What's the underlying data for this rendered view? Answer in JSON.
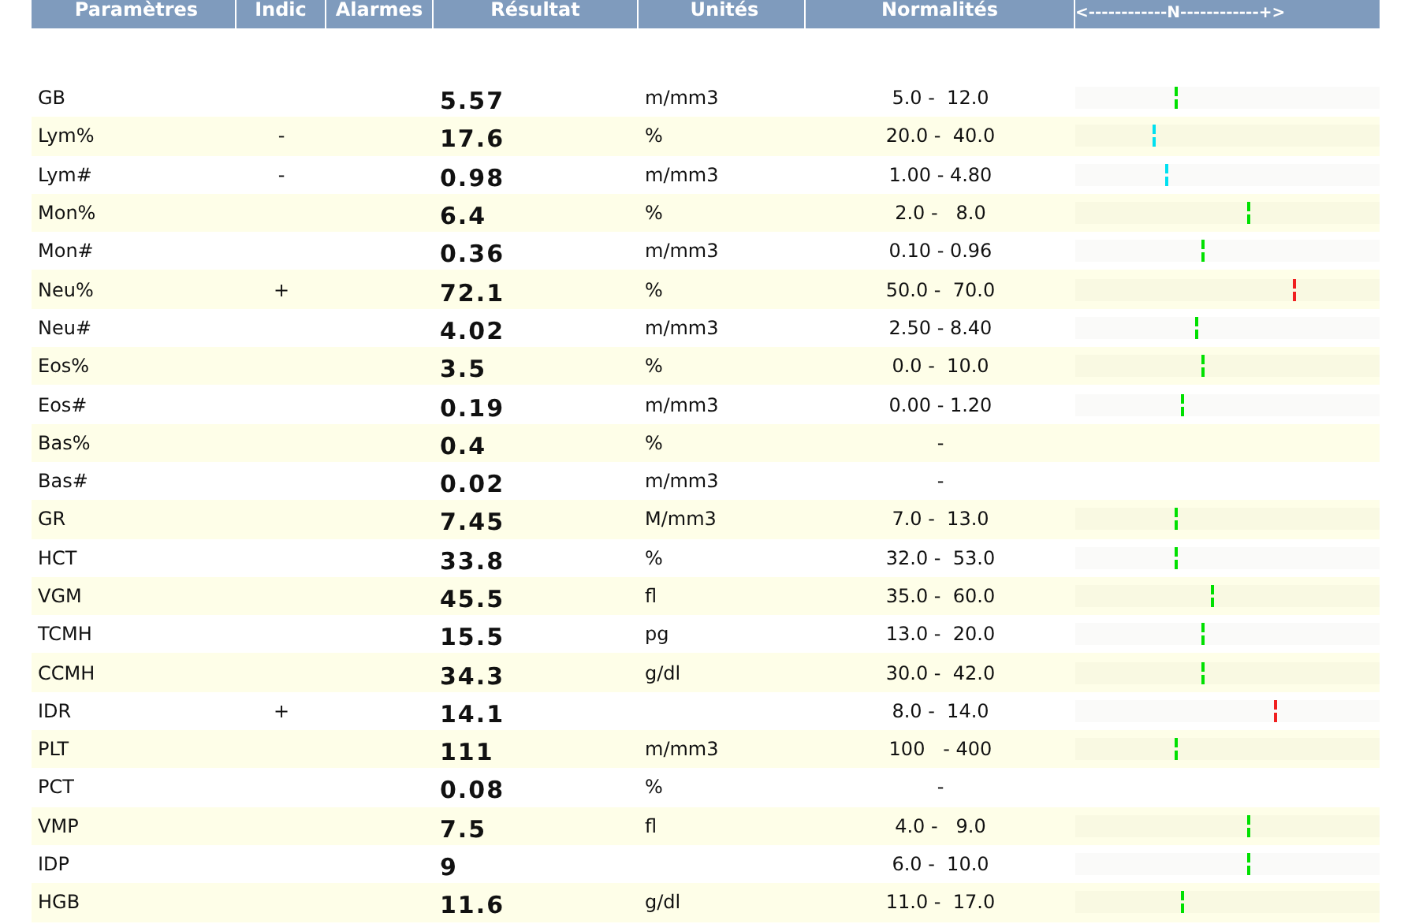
{
  "table": {
    "columns": [
      "Paramètres",
      "Indic",
      "Alarmes",
      "Résultat",
      "Unités",
      "Normalités",
      "<------------N------------+>"
    ],
    "rows": [
      {
        "param": "GB",
        "result": "5.57",
        "unit": "m/mm3",
        "range": "5.0 -  12.0",
        "level": 0.33,
        "color": "#00e000"
      },
      {
        "param": "Lym%",
        "indic": "-",
        "result": "17.6",
        "unit": "%",
        "range": "20.0 -  40.0",
        "level": 0.26,
        "color": "#00e0f0"
      },
      {
        "param": "Lym#",
        "indic": "-",
        "result": "0.98",
        "unit": "m/mm3",
        "range": "1.00 - 4.80",
        "level": 0.3,
        "color": "#00e0f0"
      },
      {
        "param": "Mon%",
        "result": "6.4",
        "unit": "%",
        "range": "2.0 -   8.0",
        "level": 0.57,
        "color": "#00e000"
      },
      {
        "param": "Mon#",
        "result": "0.36",
        "unit": "m/mm3",
        "range": "0.10 - 0.96",
        "level": 0.42,
        "color": "#00e000"
      },
      {
        "param": "Neu%",
        "indic": "+",
        "result": "72.1",
        "unit": "%",
        "range": "50.0 -  70.0",
        "level": 0.72,
        "color": "#f02020"
      },
      {
        "param": "Neu#",
        "result": "4.02",
        "unit": "m/mm3",
        "range": "2.50 - 8.40",
        "level": 0.4,
        "color": "#00e000"
      },
      {
        "param": "Eos%",
        "result": "3.5",
        "unit": "%",
        "range": "0.0 -  10.0",
        "level": 0.42,
        "color": "#00e000"
      },
      {
        "param": "Eos#",
        "result": "0.19",
        "unit": "m/mm3",
        "range": "0.00 - 1.20",
        "level": 0.35,
        "color": "#00e000"
      },
      {
        "param": "Bas%",
        "result": "0.4",
        "unit": "%",
        "range": "-"
      },
      {
        "param": "Bas#",
        "result": "0.02",
        "unit": "m/mm3",
        "range": "-"
      },
      {
        "param": "GR",
        "result": "7.45",
        "unit": "M/mm3",
        "range": "7.0 -  13.0",
        "level": 0.33,
        "color": "#00e000"
      },
      {
        "param": "HCT",
        "result": "33.8",
        "unit": "%",
        "range": "32.0 -  53.0",
        "level": 0.33,
        "color": "#00e000"
      },
      {
        "param": "VGM",
        "result": "45.5",
        "unit": "fl",
        "range": "35.0 -  60.0",
        "level": 0.45,
        "color": "#00e000"
      },
      {
        "param": "TCMH",
        "result": "15.5",
        "unit": "pg",
        "range": "13.0 -  20.0",
        "level": 0.42,
        "color": "#00e000"
      },
      {
        "param": "CCMH",
        "result": "34.3",
        "unit": "g/dl",
        "range": "30.0 -  42.0",
        "level": 0.42,
        "color": "#00e000"
      },
      {
        "param": "IDR",
        "indic": "+",
        "result": "14.1",
        "range": "8.0 -  14.0",
        "level": 0.66,
        "color": "#f02020"
      },
      {
        "param": "PLT",
        "result": "111",
        "unit": "m/mm3",
        "range": "100   - 400",
        "level": 0.33,
        "color": "#00e000"
      },
      {
        "param": "PCT",
        "result": "0.08",
        "unit": "%",
        "range": "-"
      },
      {
        "param": "VMP",
        "result": "7.5",
        "unit": "fl",
        "range": "4.0 -   9.0",
        "level": 0.57,
        "color": "#00e000"
      },
      {
        "param": "IDP",
        "result": "9",
        "range": "6.0 -  10.0",
        "level": 0.57,
        "color": "#00e000"
      },
      {
        "param": "HGB",
        "result": "11.6",
        "unit": "g/dl",
        "range": "11.0 -  17.0",
        "level": 0.35,
        "color": "#00e000"
      }
    ]
  }
}
